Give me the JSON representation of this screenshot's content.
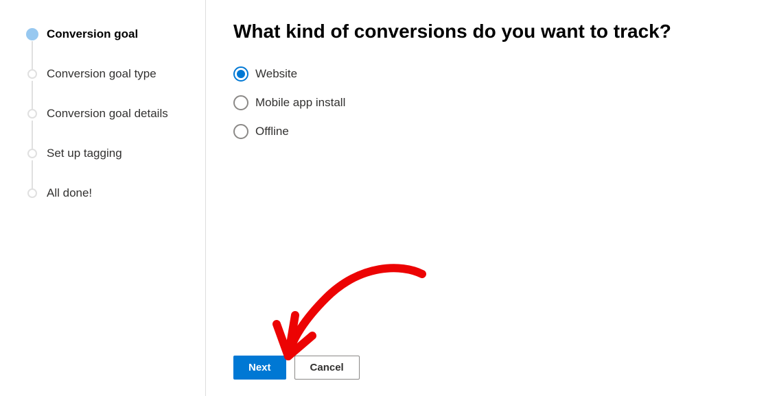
{
  "sidebar": {
    "steps": [
      {
        "label": "Conversion goal"
      },
      {
        "label": "Conversion goal type"
      },
      {
        "label": "Conversion goal details"
      },
      {
        "label": "Set up tagging"
      },
      {
        "label": "All done!"
      }
    ],
    "activeIndex": 0
  },
  "main": {
    "heading": "What kind of conversions do you want to track?",
    "options": [
      {
        "label": "Website",
        "selected": true
      },
      {
        "label": "Mobile app install",
        "selected": false
      },
      {
        "label": "Offline",
        "selected": false
      }
    ],
    "actions": {
      "primary": "Next",
      "secondary": "Cancel"
    }
  },
  "colors": {
    "primary": "#0078d4",
    "annotation": "#ec0303"
  }
}
